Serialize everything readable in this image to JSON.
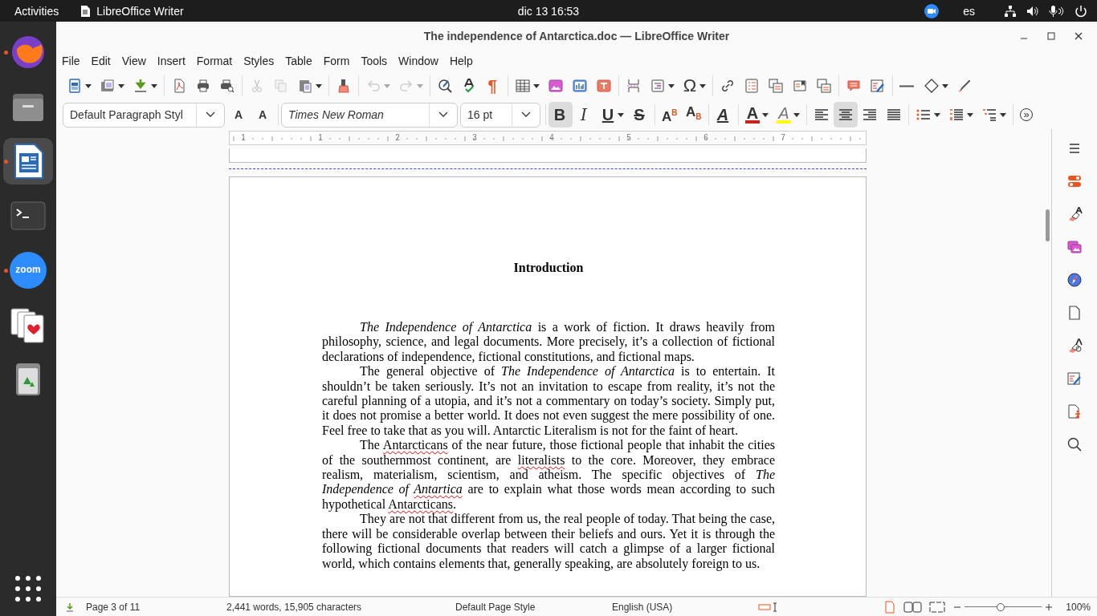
{
  "top_bar": {
    "activities": "Activities",
    "app_name": "LibreOffice Writer",
    "clock": "dic 13  16:53",
    "input_language": "es"
  },
  "dock": {
    "items": [
      {
        "kind": "browser",
        "running": true,
        "selected": false
      },
      {
        "kind": "files",
        "running": false,
        "selected": false
      },
      {
        "kind": "writer",
        "running": true,
        "selected": true
      },
      {
        "kind": "terminal",
        "running": false,
        "selected": false
      },
      {
        "kind": "zoom",
        "label": "zoom",
        "running": true,
        "selected": false
      },
      {
        "kind": "cards",
        "running": false,
        "selected": false
      },
      {
        "kind": "trash",
        "running": false,
        "selected": false
      }
    ]
  },
  "window": {
    "title": "The independence of Antarctica.doc — LibreOffice Writer"
  },
  "menu_bar": [
    "File",
    "Edit",
    "View",
    "Insert",
    "Format",
    "Styles",
    "Table",
    "Form",
    "Tools",
    "Window",
    "Help"
  ],
  "standard_toolbar": [
    {
      "kind": "new",
      "dropdown": true,
      "disabled": false
    },
    {
      "kind": "open",
      "dropdown": true,
      "disabled": false
    },
    {
      "kind": "save",
      "dropdown": true,
      "disabled": false
    },
    {
      "kind": "sep"
    },
    {
      "kind": "pdf",
      "dropdown": false,
      "disabled": false
    },
    {
      "kind": "print",
      "dropdown": false,
      "disabled": false
    },
    {
      "kind": "preview",
      "dropdown": false,
      "disabled": false
    },
    {
      "kind": "sep"
    },
    {
      "kind": "cut",
      "dropdown": false,
      "disabled": true
    },
    {
      "kind": "copy",
      "dropdown": false,
      "disabled": true
    },
    {
      "kind": "paste",
      "dropdown": true,
      "disabled": false
    },
    {
      "kind": "sep"
    },
    {
      "kind": "clone",
      "dropdown": false,
      "disabled": false
    },
    {
      "kind": "sep"
    },
    {
      "kind": "undo",
      "dropdown": true,
      "disabled": true
    },
    {
      "kind": "redo",
      "dropdown": true,
      "disabled": true
    },
    {
      "kind": "sep"
    },
    {
      "kind": "find",
      "dropdown": false,
      "disabled": false
    },
    {
      "kind": "spelling",
      "dropdown": false,
      "disabled": false
    },
    {
      "kind": "marks",
      "glyph": "¶",
      "dropdown": false,
      "disabled": false
    },
    {
      "kind": "sep"
    },
    {
      "kind": "table",
      "dropdown": true,
      "disabled": false
    },
    {
      "kind": "image",
      "dropdown": false,
      "disabled": false
    },
    {
      "kind": "chart",
      "dropdown": false,
      "disabled": false
    },
    {
      "kind": "textbox",
      "dropdown": false,
      "disabled": false
    },
    {
      "kind": "sep"
    },
    {
      "kind": "pagebreak",
      "dropdown": false,
      "disabled": false
    },
    {
      "kind": "field",
      "dropdown": true,
      "disabled": false
    },
    {
      "kind": "special",
      "glyph": "Ω",
      "dropdown": true,
      "disabled": false
    },
    {
      "kind": "sep"
    },
    {
      "kind": "link",
      "dropdown": false,
      "disabled": false
    },
    {
      "kind": "footnote",
      "dropdown": false,
      "disabled": false
    },
    {
      "kind": "endnote",
      "dropdown": false,
      "disabled": false
    },
    {
      "kind": "bookmark",
      "dropdown": false,
      "disabled": false
    },
    {
      "kind": "crossref",
      "dropdown": false,
      "disabled": false
    },
    {
      "kind": "sep"
    },
    {
      "kind": "comment",
      "dropdown": false,
      "disabled": false
    },
    {
      "kind": "track",
      "dropdown": false,
      "disabled": false
    },
    {
      "kind": "sep"
    },
    {
      "kind": "line",
      "dropdown": false,
      "disabled": false
    },
    {
      "kind": "shapes",
      "dropdown": true,
      "disabled": false
    },
    {
      "kind": "draw",
      "dropdown": false,
      "disabled": false
    }
  ],
  "formatting_toolbar": {
    "paragraph_style": "Default Paragraph Styl",
    "font_name": "Times New Roman",
    "font_size": "16 pt",
    "buttons": [
      {
        "kind": "newstyle",
        "glyph": "A",
        "dropdown": false,
        "on": false
      },
      {
        "kind": "updatestyle",
        "glyph": "A",
        "dropdown": false,
        "on": false
      },
      {
        "kind": "fontbox"
      },
      {
        "kind": "bold",
        "glyph": "B",
        "dropdown": false,
        "on": true
      },
      {
        "kind": "italic",
        "glyph": "I",
        "dropdown": false,
        "on": false
      },
      {
        "kind": "underline",
        "glyph": "U",
        "dropdown": true,
        "on": false
      },
      {
        "kind": "strike",
        "glyph": "S",
        "dropdown": false,
        "on": false
      },
      {
        "kind": "sep"
      },
      {
        "kind": "superscript",
        "glyph": "A$^{B}$",
        "dropdown": false,
        "on": false
      },
      {
        "kind": "subscript",
        "glyph": "A$_{B}$",
        "dropdown": false,
        "on": false
      },
      {
        "kind": "sep"
      },
      {
        "kind": "clear",
        "glyph": "A",
        "dropdown": false,
        "on": false
      },
      {
        "kind": "sep"
      },
      {
        "kind": "fontcolor",
        "glyph": "A",
        "dropdown": true,
        "on": false
      },
      {
        "kind": "highlight",
        "glyph": "A",
        "dropdown": true,
        "on": false
      },
      {
        "kind": "sep"
      },
      {
        "kind": "left",
        "dropdown": false,
        "on": false
      },
      {
        "kind": "center",
        "dropdown": false,
        "on": true
      },
      {
        "kind": "right",
        "dropdown": false,
        "on": false
      },
      {
        "kind": "justify",
        "dropdown": false,
        "on": false
      },
      {
        "kind": "sep"
      },
      {
        "kind": "bullets",
        "dropdown": true,
        "on": false
      },
      {
        "kind": "numbering",
        "dropdown": true,
        "on": false
      },
      {
        "kind": "outline",
        "dropdown": true,
        "on": false
      },
      {
        "kind": "sep"
      },
      {
        "kind": "more",
        "glyph": "»",
        "dropdown": false,
        "on": false
      }
    ]
  },
  "ruler": {
    "labels": [
      "1",
      "1",
      "2",
      "3",
      "4",
      "5",
      "6",
      "7"
    ]
  },
  "document": {
    "heading": "Introduction",
    "paragraphs": [
      [
        {
          "text": "The Independence of Antarctica",
          "italic": true,
          "misspelled": false
        },
        {
          "text": " is a work of fiction. It draws heavily from philosophy, science, and legal documents. More precisely, it’s a collection of fictional declarations of independence, fictional constitutions, and fictional maps.",
          "italic": false,
          "misspelled": false
        }
      ],
      [
        {
          "text": "The general objective of ",
          "italic": false,
          "misspelled": false
        },
        {
          "text": "The Independence of Antarctica",
          "italic": true,
          "misspelled": false
        },
        {
          "text": " is to entertain. It shouldn’t be taken seriously. It’s not an invitation to escape from reality, it’s not the careful planning of a utopia, and it’s not a commentary on today’s society. Simply put, it does not promise a better world. It does not even suggest the mere possibility of one. Feel free to take that as you will. Antarctic Literalism is not for the faint of heart.",
          "italic": false,
          "misspelled": false
        }
      ],
      [
        {
          "text": "The ",
          "italic": false,
          "misspelled": false
        },
        {
          "text": "Antarcticans",
          "italic": false,
          "misspelled": true
        },
        {
          "text": " of the near future, those fictional people that inhabit the cities of the southernmost continent, are ",
          "italic": false,
          "misspelled": false
        },
        {
          "text": "literalists",
          "italic": false,
          "misspelled": true
        },
        {
          "text": " to the core. Moreover, they embrace realism, materialism, scientism, and atheism. The specific objectives of ",
          "italic": false,
          "misspelled": false
        },
        {
          "text": "The Independence of ",
          "italic": true,
          "misspelled": false
        },
        {
          "text": "Antartica",
          "italic": true,
          "misspelled": true
        },
        {
          "text": " are to explain what those words mean according to such hypothetical ",
          "italic": false,
          "misspelled": false
        },
        {
          "text": "Antarcticans",
          "italic": false,
          "misspelled": true
        },
        {
          "text": ".",
          "italic": false,
          "misspelled": false
        }
      ],
      [
        {
          "text": "They are not that different from us, the real people of today. That being the case, there will be considerable overlap between their beliefs and ours. Yet it is through the following fictional documents that readers will catch a glimpse of a larger fictional world, which contains elements that, generally speaking, are absolutely foreign to us.",
          "italic": false,
          "misspelled": false
        }
      ]
    ]
  },
  "sidebar": [
    {
      "kind": "menu"
    },
    {
      "kind": "properties"
    },
    {
      "kind": "styles"
    },
    {
      "kind": "gallery"
    },
    {
      "kind": "navigator"
    },
    {
      "kind": "page"
    },
    {
      "kind": "manage-styles"
    },
    {
      "kind": "inspector"
    },
    {
      "kind": "accessibility"
    },
    {
      "kind": "find"
    }
  ],
  "status_bar": {
    "page": "Page 3 of 11",
    "word_count": "2,441 words, 15,905 characters",
    "page_style": "Default Page Style",
    "language": "English (USA)",
    "zoom_slider": {
      "level": 0.47
    },
    "zoom": "100%"
  }
}
